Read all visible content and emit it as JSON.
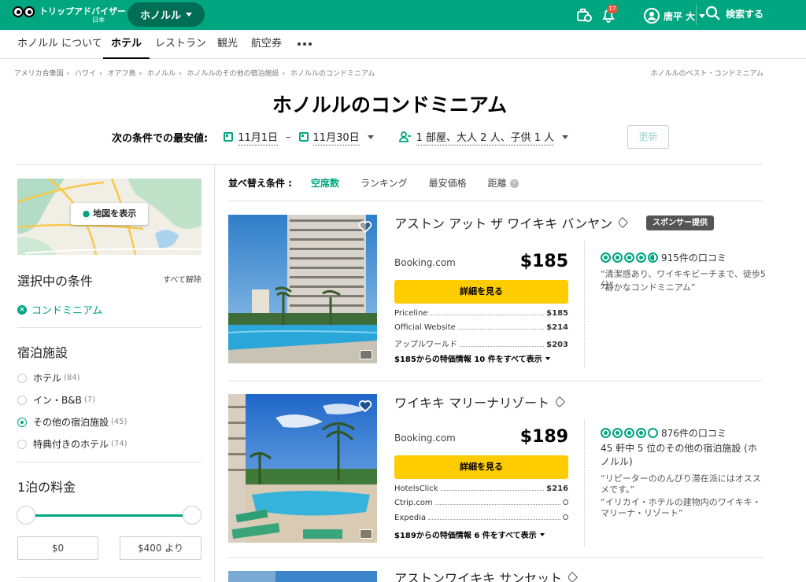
{
  "header": {
    "logo_text": "トリップアドバイザー",
    "logo_sub": "日本",
    "geo": "ホノルル",
    "notif_count": "17",
    "user": "唐平 大",
    "search": "検索する"
  },
  "subnav": {
    "tabs": [
      "ホノルル について",
      "ホテル",
      "レストラン",
      "観光",
      "航空券"
    ]
  },
  "breadcrumbs": [
    "アメリカ合衆国",
    "ハワイ",
    "オアフ島",
    "ホノルル",
    "ホノルルのその他の宿泊施設",
    "ホノルルのコンドミニアム"
  ],
  "breadcrumb_right": "ホノルルのベスト・コンドミニアム",
  "title": "ホノルルのコンドミニアム",
  "dates": {
    "label": "次の条件での最安値:",
    "checkin": "11月1日",
    "dash": "–",
    "checkout": "11月30日",
    "guests": "1 部屋、大人 2 人、子供 1 人",
    "update": "更新"
  },
  "sidebar": {
    "map_button": "地図を表示",
    "selected_heading": "選択中の条件",
    "clear_all": "すべて解除",
    "selected_chip": "コンドミニアム",
    "lodging_heading": "宿泊施設",
    "lodging": [
      {
        "label": "ホテル",
        "count": "(84)"
      },
      {
        "label": "イン・B&B",
        "count": "(7)"
      },
      {
        "label": "その他の宿泊施設",
        "count": "(45)"
      },
      {
        "label": "特典付きのホテル",
        "count": "(74)"
      }
    ],
    "price_heading": "1泊の料金",
    "price_min": "$0",
    "price_max": "$400 より"
  },
  "sort": {
    "label": "並べ替え条件 :",
    "options": [
      "空席数",
      "ランキング",
      "最安価格",
      "距離"
    ],
    "help": "?"
  },
  "hotels": [
    {
      "name": "アストン アット ザ ワイキキ バンヤン",
      "sponsor": "スポンサー提供",
      "provider": "Booking.com",
      "price": "$185",
      "deal_button": "詳細を見る",
      "offers": [
        {
          "name": "Priceline",
          "value": "$185"
        },
        {
          "name": "Official Website",
          "value": "$214"
        },
        {
          "name": "アップルワールド",
          "value": "$203"
        }
      ],
      "all_deals": "$185からの特価情報 10 件をすべて表示",
      "reviews": "915件の口コミ",
      "snippets": [
        "“清潔感あり、ワイキキビーチまで、徒歩5分”",
        "“静かなコンドミニアム”"
      ]
    },
    {
      "name": "ワイキキ マリーナリゾート",
      "provider": "Booking.com",
      "price": "$189",
      "deal_button": "詳細を見る",
      "offers": [
        {
          "name": "HotelsClick",
          "value": "$216"
        },
        {
          "name": "Ctrip.com",
          "value": ""
        },
        {
          "name": "Expedia",
          "value": ""
        }
      ],
      "all_deals": "$189からの特価情報 6 件をすべて表示",
      "reviews": "876件の口コミ",
      "rank": "45 軒中 5 位のその他の宿泊施設 (ホノルル)",
      "snippets": [
        "“リピーターののんびり滞在派にはオススメです。”",
        "“イリカイ・ホテルの建物内のワイキキ・マリーナ・リゾート”"
      ]
    },
    {
      "name": "アストンワイキキ サンセット"
    }
  ],
  "colors": {
    "brand": "#00a680",
    "deal": "#ffcc00"
  }
}
